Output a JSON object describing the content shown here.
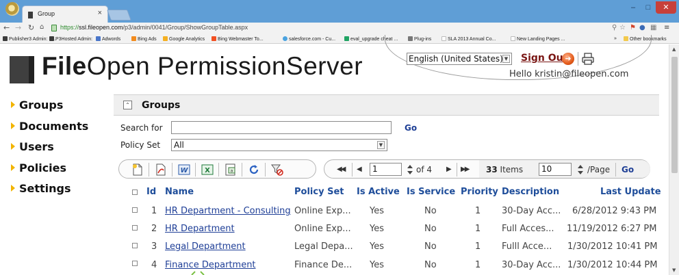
{
  "browser": {
    "tab_title": "Group",
    "tab_close": "×",
    "url_scheme": "https://",
    "url_host": "ssl.fileopen.com",
    "url_path": "/p3/admin/0041/Group/ShowGroupTable.aspx",
    "bookmarks": [
      {
        "label": "Publisher3 Admin: S...",
        "color": "#3b3b3b"
      },
      {
        "label": "P3Hosted Admin:",
        "color": "#3b3b3b"
      },
      {
        "label": "Adwords",
        "color": "#4a76c9"
      },
      {
        "label": "Bing Ads",
        "color": "#f28b1e"
      },
      {
        "label": "Google Analytics",
        "color": "#f5b021"
      },
      {
        "label": "Bing Webmaster To...",
        "color": "#f25022"
      },
      {
        "label": "salesforce.com - Cu...",
        "color": "#4aa3e0"
      },
      {
        "label": "eval_upgrade cheat ...",
        "color": "#21a464"
      },
      {
        "label": "Plug-ins",
        "color": "#777777"
      },
      {
        "label": "SLA 2013 Annual Co...",
        "color": "#bbbbbb"
      },
      {
        "label": "New Landing Pages ...",
        "color": "#bbbbbb"
      }
    ],
    "bookmarks_overflow": "»",
    "other_bookmarks": "Other bookmarks"
  },
  "header": {
    "logo_bold": "File",
    "logo_light": "Open",
    "logo_rest": " PermissionServer",
    "language": "English (United States)",
    "sign_out": "Sign Out",
    "hello": "Hello kristin@fileopen.com"
  },
  "sidebar": {
    "items": [
      {
        "label": "Groups"
      },
      {
        "label": "Documents"
      },
      {
        "label": "Users"
      },
      {
        "label": "Policies"
      },
      {
        "label": "Settings"
      }
    ]
  },
  "main": {
    "section_title": "Groups",
    "search_label": "Search for",
    "search_value": "",
    "go_label": "Go",
    "policy_label": "Policy Set",
    "policy_value": "All",
    "pager": {
      "page": "1",
      "of_text": "of 4",
      "items_count": "33",
      "items_label": "Items",
      "per_page": "10",
      "per_page_label": "/Page",
      "go_label": "Go"
    }
  },
  "table": {
    "headers": {
      "id": "Id",
      "name": "Name",
      "policy_set": "Policy Set",
      "is_active": "Is Active",
      "is_service": "Is Service",
      "priority": "Priority",
      "description": "Description",
      "last_update": "Last Update"
    },
    "rows": [
      {
        "id": "1",
        "name": "HR Department - Consulting",
        "policy_set": "Online Exp...",
        "is_active": "Yes",
        "is_service": "No",
        "priority": "1",
        "description": "30-Day Acc...",
        "last_update": "6/28/2012 9:43 PM"
      },
      {
        "id": "2",
        "name": "HR Department",
        "policy_set": "Online Exp...",
        "is_active": "Yes",
        "is_service": "No",
        "priority": "1",
        "description": "Full Acces...",
        "last_update": "11/19/2012 6:27 PM"
      },
      {
        "id": "3",
        "name": "Legal Department",
        "policy_set": "Legal Depa...",
        "is_active": "Yes",
        "is_service": "No",
        "priority": "1",
        "description": "Fulll Acce...",
        "last_update": "1/30/2012 10:41 PM"
      },
      {
        "id": "4",
        "name": "Finance Department",
        "policy_set": "Finance De...",
        "is_active": "Yes",
        "is_service": "No",
        "priority": "1",
        "description": "30-Day Acc...",
        "last_update": "1/30/2012 10:44 PM"
      }
    ]
  },
  "colors": {
    "accent_link": "#1f3f97",
    "sidebar_arrow": "#f2b400",
    "signout": "#7a1614"
  }
}
